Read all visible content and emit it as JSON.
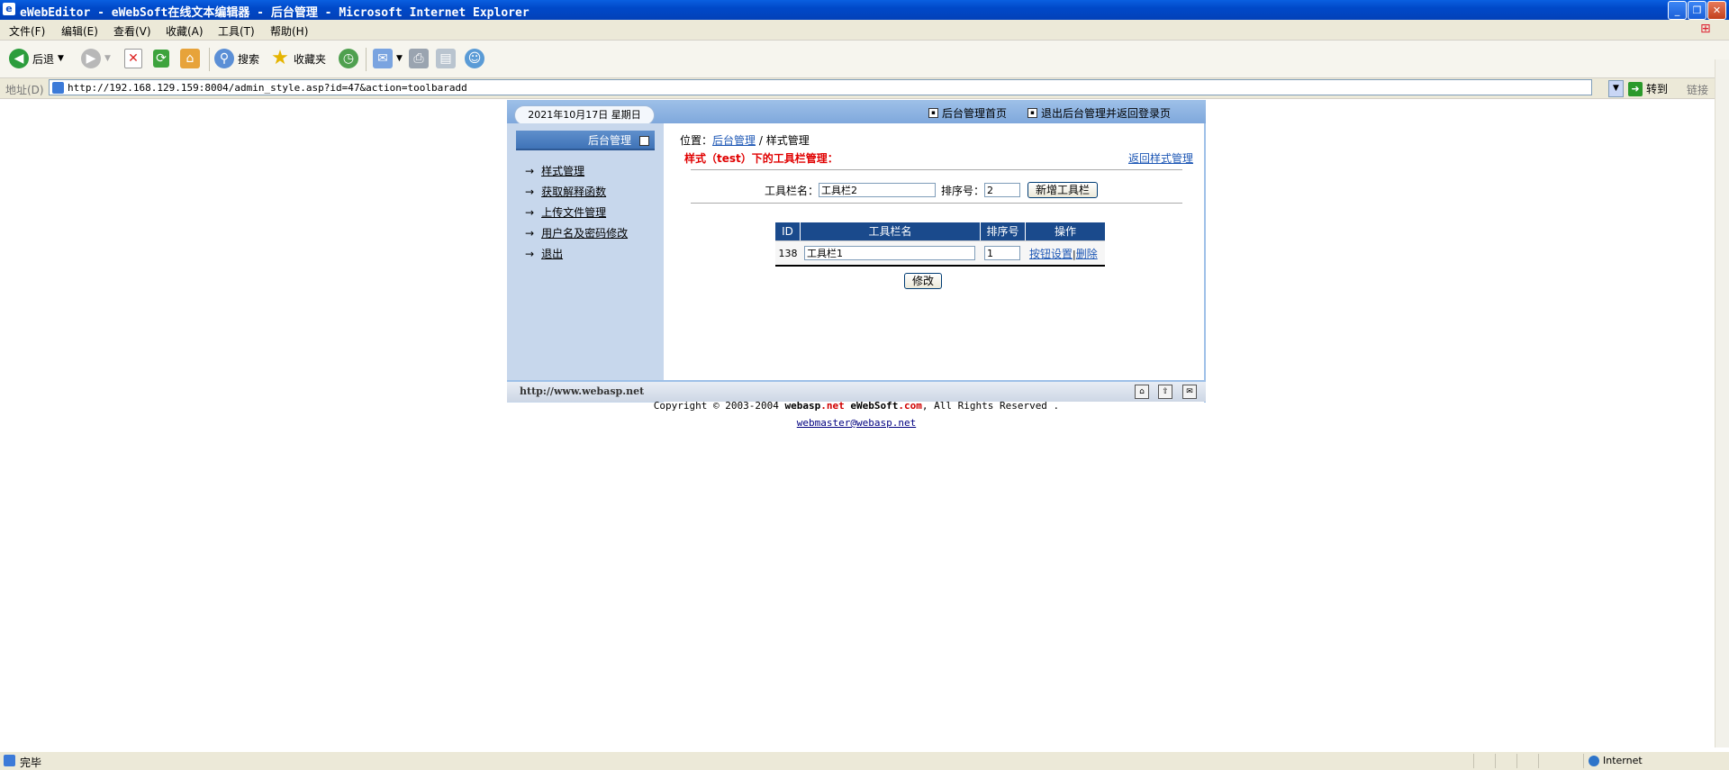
{
  "window": {
    "title": "eWebEditor - eWebSoft在线文本编辑器 - 后台管理 - Microsoft Internet Explorer"
  },
  "menu": [
    "文件(F)",
    "编辑(E)",
    "查看(V)",
    "收藏(A)",
    "工具(T)",
    "帮助(H)"
  ],
  "toolbar": {
    "back_label": "后退",
    "search_label": "搜索",
    "favorites_label": "收藏夹"
  },
  "address": {
    "label": "地址(D)",
    "url": "http://192.168.129.159:8004/admin_style.asp?id=47&action=toolbaradd",
    "go_label": "转到",
    "links_label": "链接"
  },
  "page": {
    "date": "2021年10月17日 星期日",
    "top_nav": [
      "后台管理首页",
      "退出后台管理并返回登录页"
    ],
    "sidebar": {
      "title": "后台管理",
      "items": [
        "样式管理",
        "获取解释函数",
        "上传文件管理",
        "用户名及密码修改",
        "退出"
      ]
    },
    "location": {
      "prefix": "位置：",
      "link": "后台管理",
      "sep": " / ",
      "current": "样式管理"
    },
    "heading": "样式（test）下的工具栏管理：",
    "back_link": "返回样式管理",
    "form": {
      "name_label": "工具栏名：",
      "name_value": "工具栏2",
      "order_label": "排序号：",
      "order_value": "2",
      "add_button": "新增工具栏"
    },
    "table": {
      "headers": [
        "ID",
        "工具栏名",
        "排序号",
        "操作"
      ],
      "rows": [
        {
          "id": "138",
          "name": "工具栏1",
          "order": "1",
          "action1": "按钮设置",
          "pipe": "|",
          "action2": "删除"
        }
      ]
    },
    "modify_button": "修改",
    "footer_url": "http://www.webasp.net",
    "copyright_pre": "Copyright © 2003-2004 ",
    "copyright_site1a": "webasp",
    "copyright_site1b": ".net",
    "copyright_site2a": "eWebSoft",
    "copyright_site2b": ".com",
    "copyright_post": ", All Rights Reserved .",
    "email": "webmaster@webasp.net"
  },
  "status": {
    "text": "完毕",
    "zone": "Internet"
  }
}
